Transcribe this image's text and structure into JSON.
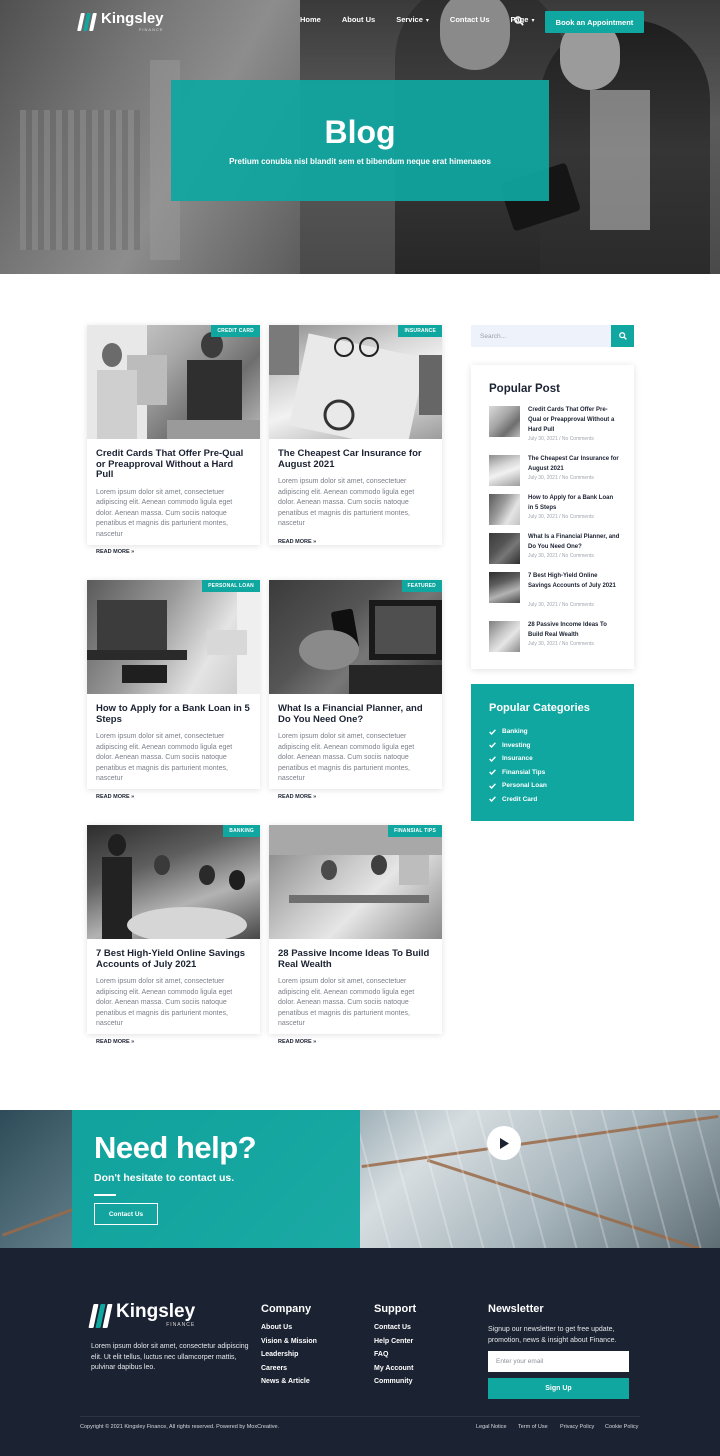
{
  "brand": {
    "name": "Kingsley",
    "sub": "FINANCE",
    "accent": "#10a7a0",
    "dark": "#1b2231"
  },
  "nav": {
    "items": [
      "Home",
      "About Us",
      "Service",
      "Contact Us",
      "Page"
    ],
    "cta": "Book an Appointment"
  },
  "hero": {
    "title": "Blog",
    "subtitle": "Pretium conubia nisl blandit sem et bibendum neque erat himenaeos"
  },
  "posts": [
    {
      "tag": "CREDIT CARD",
      "title": "Credit Cards That Offer Pre-Qual or Preapproval Without a Hard Pull",
      "excerpt": "Lorem ipsum dolor sit amet, consectetuer adipiscing elit. Aenean commodo ligula eget dolor. Aenean massa. Cum sociis natoque penatibus et magnis dis parturient montes, nascetur",
      "more": "READ MORE »"
    },
    {
      "tag": "INSURANCE",
      "title": "The Cheapest Car Insurance for August 2021",
      "excerpt": "Lorem ipsum dolor sit amet, consectetuer adipiscing elit. Aenean commodo ligula eget dolor. Aenean massa. Cum sociis natoque penatibus et magnis dis parturient montes, nascetur",
      "more": "READ MORE »"
    },
    {
      "tag": "PERSONAL LOAN",
      "title": "How to Apply for a Bank Loan in 5 Steps",
      "excerpt": "Lorem ipsum dolor sit amet, consectetuer adipiscing elit. Aenean commodo ligula eget dolor. Aenean massa. Cum sociis natoque penatibus et magnis dis parturient montes, nascetur",
      "more": "READ MORE »"
    },
    {
      "tag": "FEATURED",
      "title": "What Is a Financial Planner, and Do You Need One?",
      "excerpt": "Lorem ipsum dolor sit amet, consectetuer adipiscing elit. Aenean commodo ligula eget dolor. Aenean massa. Cum sociis natoque penatibus et magnis dis parturient montes, nascetur",
      "more": "READ MORE »"
    },
    {
      "tag": "BANKING",
      "title": "7 Best High-Yield Online Savings Accounts of July 2021",
      "excerpt": "Lorem ipsum dolor sit amet, consectetuer adipiscing elit. Aenean commodo ligula eget dolor. Aenean massa. Cum sociis natoque penatibus et magnis dis parturient montes, nascetur",
      "more": "READ MORE »"
    },
    {
      "tag": "FINANSIAL TIPS",
      "title": "28 Passive Income Ideas To Build Real Wealth",
      "excerpt": "Lorem ipsum dolor sit amet, consectetuer adipiscing elit. Aenean commodo ligula eget dolor. Aenean massa. Cum sociis natoque penatibus et magnis dis parturient montes, nascetur",
      "more": "READ MORE »"
    }
  ],
  "sidebar": {
    "search_placeholder": "Search...",
    "popular_title": "Popular Post",
    "popular": [
      {
        "title": "Credit Cards That Offer Pre-Qual or Preapproval Without a Hard Pull",
        "meta": "July 30, 2021 / No Comments"
      },
      {
        "title": "The Cheapest Car Insurance for August 2021",
        "meta": "July 30, 2021 / No Comments"
      },
      {
        "title": "How to Apply for a Bank Loan in 5 Steps",
        "meta": "July 30, 2021 / No Comments"
      },
      {
        "title": "What Is a Financial Planner, and Do You Need One?",
        "meta": "July 30, 2021 / No Comments"
      },
      {
        "title": "7 Best High-Yield Online Savings Accounts of July 2021",
        "meta": "July 30, 2021 / No Comments"
      },
      {
        "title": "28 Passive Income Ideas To Build Real Wealth",
        "meta": "July 30, 2021 / No Comments"
      }
    ],
    "categories_title": "Popular Categories",
    "categories": [
      "Banking",
      "Investing",
      "Insurance",
      "Finansial Tips",
      "Personal Loan",
      "Credit Card"
    ]
  },
  "help": {
    "title": "Need help?",
    "subtitle": "Don't hesitate to contact us.",
    "button": "Contact Us"
  },
  "footer": {
    "about": "Lorem ipsum dolor sit amet, consectetur adipiscing elit. Ut elit tellus, luctus nec ullamcorper mattis, pulvinar dapibus leo.",
    "company_title": "Company",
    "company": [
      "About Us",
      "Vision & Mission",
      "Leadership",
      "Careers",
      "News & Article"
    ],
    "support_title": "Support",
    "support": [
      "Contact Us",
      "Help Center",
      "FAQ",
      "My Account",
      "Community"
    ],
    "newsletter_title": "Newsletter",
    "newsletter_text": "Signup our newsletter to get free update, promotion, news & insight about Finance.",
    "email_placeholder": "Enter your email",
    "signup": "Sign Up",
    "copyright": "Copyright © 2021 Kingsley Finance, All rights reserved. Powered by MoxCreative.",
    "legal": [
      "Legal Notice",
      "Term of Use",
      "Privacy Policy",
      "Cookie Policy"
    ]
  }
}
